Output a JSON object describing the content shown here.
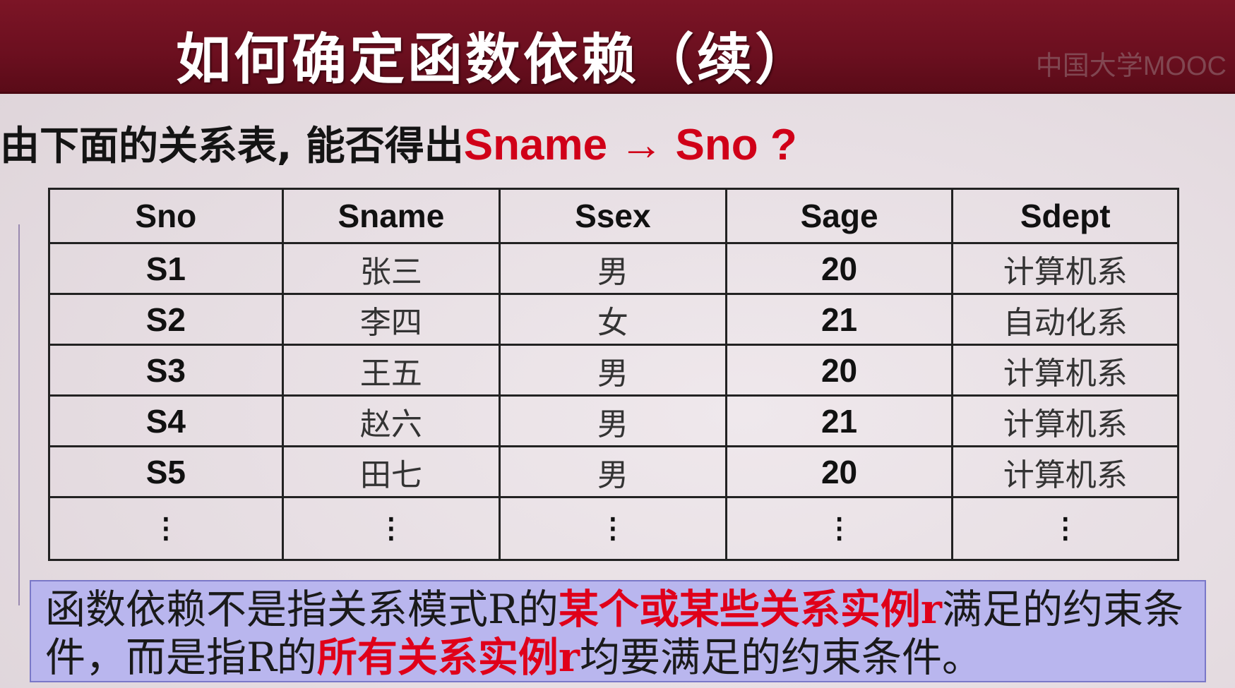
{
  "title": "如何确定函数依赖（续）",
  "logo": "中国大学MOOC",
  "question": {
    "prefix": "由下面的关系表, 能否得出",
    "highlight": "Sname → Sno ?"
  },
  "table": {
    "headers": [
      "Sno",
      "Sname",
      "Ssex",
      "Sage",
      "Sdept"
    ],
    "rows": [
      [
        "S1",
        "张三",
        "男",
        "20",
        "计算机系"
      ],
      [
        "S2",
        "李四",
        "女",
        "21",
        "自动化系"
      ],
      [
        "S3",
        "王五",
        "男",
        "20",
        "计算机系"
      ],
      [
        "S4",
        "赵六",
        "男",
        "21",
        "计算机系"
      ],
      [
        "S5",
        "田七",
        "男",
        "20",
        "计算机系"
      ]
    ],
    "ellipsis": "⋮"
  },
  "note": {
    "p1": "函数依赖不是指关系模式R的",
    "r1": "某个或某些关系实例r",
    "p2": "满足的约束条件，而是指R的",
    "r2": "所有关系实例r",
    "p3": "均要满足的约束条件。"
  },
  "colors": {
    "title_bg": "#6b0f1f",
    "highlight_red": "#d00018",
    "note_bg": "#b9b6ee"
  }
}
